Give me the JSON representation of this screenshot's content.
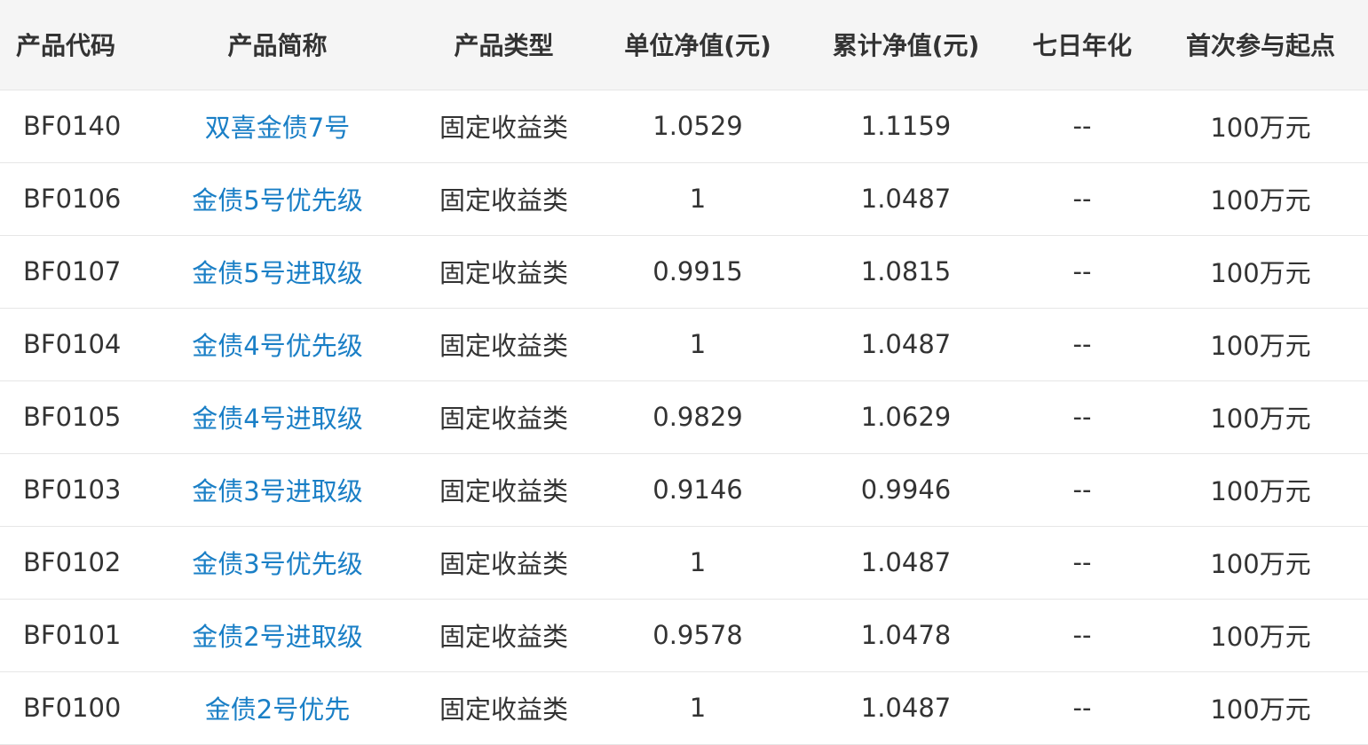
{
  "table": {
    "headers": [
      "产品代码",
      "产品简称",
      "产品类型",
      "单位净值(元)",
      "累计净值(元)",
      "七日年化",
      "首次参与起点"
    ],
    "rows": [
      {
        "code": "BF0140",
        "name": "双喜金债7号",
        "type": "固定收益类",
        "unit_nav": "1.0529",
        "acc_nav": "1.1159",
        "seven_day": "--",
        "min_invest": "100万元"
      },
      {
        "code": "BF0106",
        "name": "金债5号优先级",
        "type": "固定收益类",
        "unit_nav": "1",
        "acc_nav": "1.0487",
        "seven_day": "--",
        "min_invest": "100万元"
      },
      {
        "code": "BF0107",
        "name": "金债5号进取级",
        "type": "固定收益类",
        "unit_nav": "0.9915",
        "acc_nav": "1.0815",
        "seven_day": "--",
        "min_invest": "100万元"
      },
      {
        "code": "BF0104",
        "name": "金债4号优先级",
        "type": "固定收益类",
        "unit_nav": "1",
        "acc_nav": "1.0487",
        "seven_day": "--",
        "min_invest": "100万元"
      },
      {
        "code": "BF0105",
        "name": "金债4号进取级",
        "type": "固定收益类",
        "unit_nav": "0.9829",
        "acc_nav": "1.0629",
        "seven_day": "--",
        "min_invest": "100万元"
      },
      {
        "code": "BF0103",
        "name": "金债3号进取级",
        "type": "固定收益类",
        "unit_nav": "0.9146",
        "acc_nav": "0.9946",
        "seven_day": "--",
        "min_invest": "100万元"
      },
      {
        "code": "BF0102",
        "name": "金债3号优先级",
        "type": "固定收益类",
        "unit_nav": "1",
        "acc_nav": "1.0487",
        "seven_day": "--",
        "min_invest": "100万元"
      },
      {
        "code": "BF0101",
        "name": "金债2号进取级",
        "type": "固定收益类",
        "unit_nav": "0.9578",
        "acc_nav": "1.0478",
        "seven_day": "--",
        "min_invest": "100万元"
      },
      {
        "code": "BF0100",
        "name": "金债2号优先",
        "type": "固定收益类",
        "unit_nav": "1",
        "acc_nav": "1.0487",
        "seven_day": "--",
        "min_invest": "100万元"
      }
    ]
  },
  "colors": {
    "link": "#1a7fc6",
    "header_bg": "#f5f5f5",
    "border": "#e6e6e6",
    "text": "#333333"
  }
}
